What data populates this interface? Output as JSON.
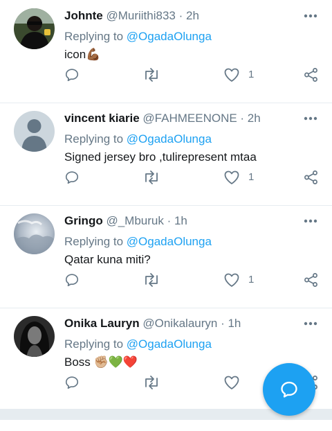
{
  "replies": [
    {
      "name": "Johnte",
      "handle": "@Muriithi833",
      "time": "· 2h",
      "replying_label": "Replying to",
      "replying_to": "@OgadaOlunga",
      "text": "icon💪🏾",
      "likes": "1",
      "avatar": "photo-dark-person"
    },
    {
      "name": "vincent kiarie",
      "handle": "@FAHMEENONE",
      "time": "· 2h",
      "replying_label": "Replying to",
      "replying_to": "@OgadaOlunga",
      "text": "Signed jersey bro ,tulirepresent mtaa",
      "likes": "1",
      "avatar": "default-profile"
    },
    {
      "name": "Gringo",
      "handle": "@_Mburuk",
      "time": "· 1h",
      "replying_label": "Replying to",
      "replying_to": "@OgadaOlunga",
      "text": "Qatar kuna miti?",
      "likes": "1",
      "avatar": "photo-clouds"
    },
    {
      "name": "Onika Lauryn",
      "handle": "@Onikalauryn",
      "time": "· 1h",
      "replying_label": "Replying to",
      "replying_to": "@OgadaOlunga",
      "text": "Boss ✊🏼💚❤️",
      "likes": "",
      "avatar": "photo-woman-bw"
    }
  ],
  "colors": {
    "accent": "#1da1f2",
    "secondary_text": "#657786",
    "divider": "#e6ecf0"
  },
  "fab": {
    "icon": "compose-reply-icon"
  }
}
